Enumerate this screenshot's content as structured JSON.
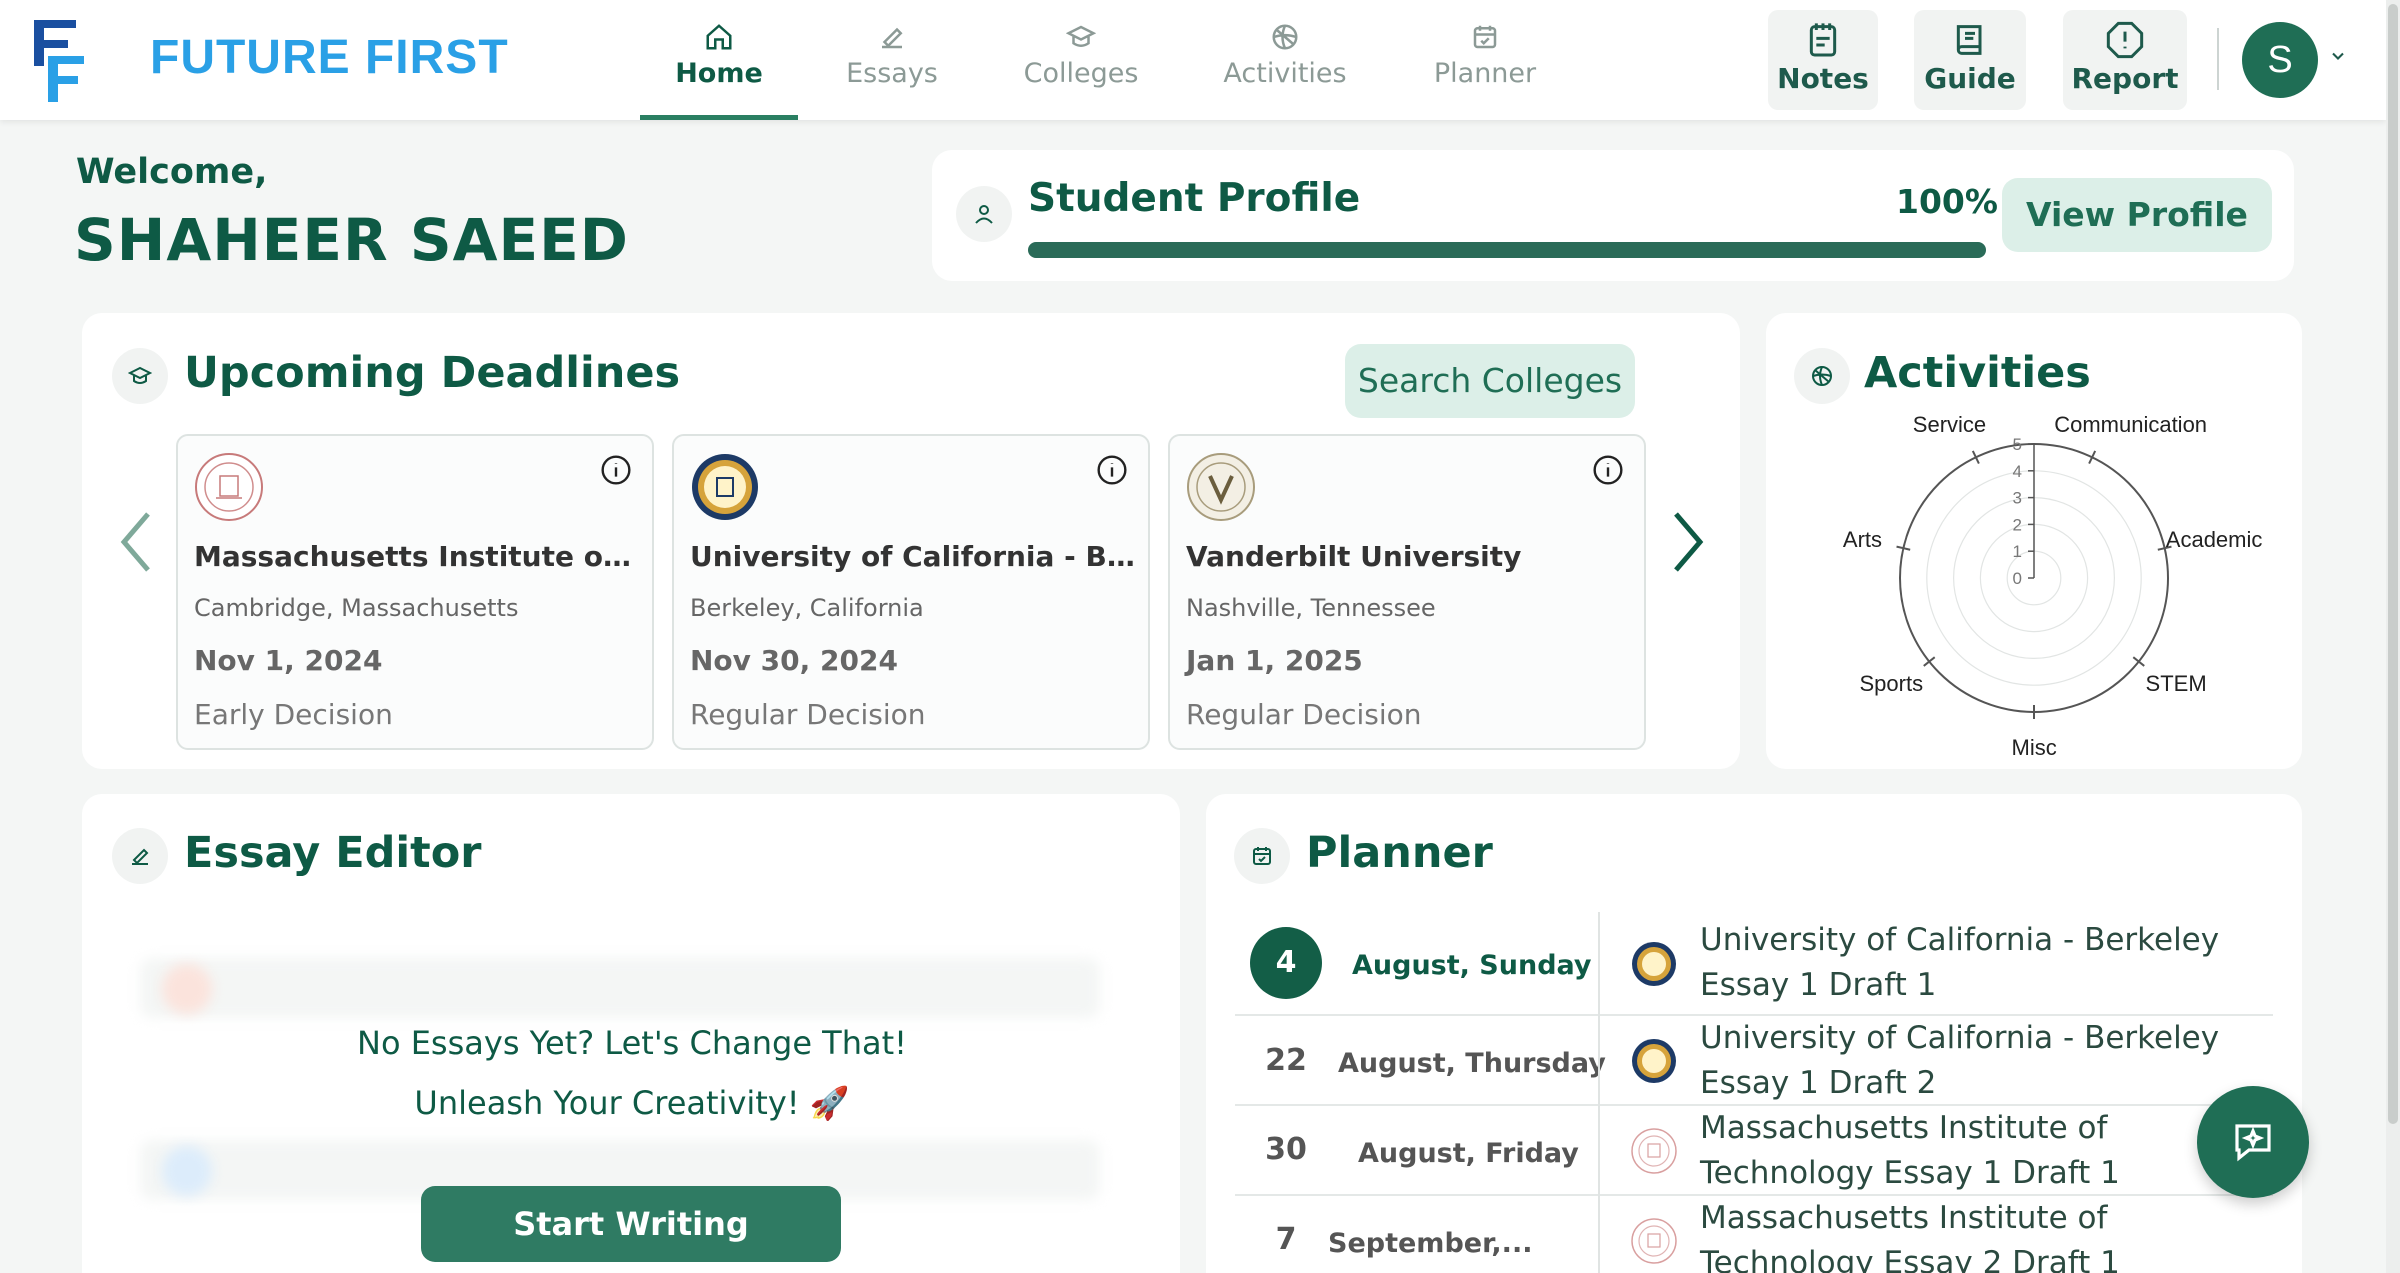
{
  "brand": "FUTURE FIRST",
  "nav": [
    {
      "label": "Home",
      "icon": "home-icon",
      "active": true
    },
    {
      "label": "Essays",
      "icon": "essay-icon"
    },
    {
      "label": "Colleges",
      "icon": "graduation-cap-icon"
    },
    {
      "label": "Activities",
      "icon": "activity-ball-icon"
    },
    {
      "label": "Planner",
      "icon": "calendar-icon"
    }
  ],
  "tools": [
    {
      "label": "Notes",
      "icon": "notes-icon"
    },
    {
      "label": "Guide",
      "icon": "book-icon"
    },
    {
      "label": "Report",
      "icon": "alert-icon"
    }
  ],
  "user": {
    "initial": "S"
  },
  "welcome": {
    "greeting": "Welcome,",
    "name": "SHAHEER SAEED"
  },
  "profile": {
    "title": "Student Profile",
    "percent_text": "100%",
    "progress": 1.0,
    "button": "View Profile"
  },
  "deadlines": {
    "title": "Upcoming Deadlines",
    "search_button": "Search Colleges",
    "cards": [
      {
        "name": "Massachusetts Institute of Tec...",
        "location": "Cambridge, Massachusetts",
        "date": "Nov 1, 2024",
        "type": "Early Decision"
      },
      {
        "name": "University of California - Berke...",
        "location": "Berkeley, California",
        "date": "Nov 30, 2024",
        "type": "Regular Decision"
      },
      {
        "name": "Vanderbilt University",
        "location": "Nashville, Tennessee",
        "date": "Jan 1, 2025",
        "type": "Regular Decision"
      }
    ]
  },
  "activities": {
    "title": "Activities",
    "axes": [
      "Communication",
      "Academic",
      "STEM",
      "Misc",
      "Sports",
      "Arts",
      "Service"
    ],
    "ticks": [
      "0",
      "1",
      "2",
      "3",
      "4",
      "5"
    ],
    "values": [
      0,
      0,
      0,
      0,
      0,
      0,
      0
    ]
  },
  "essay_editor": {
    "title": "Essay Editor",
    "empty_line1": "No Essays Yet? Let's Change That!",
    "empty_line2": "Unleash Your Creativity! 🚀",
    "button": "Start Writing"
  },
  "planner": {
    "title": "Planner",
    "rows": [
      {
        "day": "4",
        "date": "August, Sunday",
        "line1": "University of California - Berkeley",
        "line2": "Essay 1 Draft 1",
        "college": "berkeley"
      },
      {
        "day": "22",
        "date": "August, Thursday",
        "line1": "University of California - Berkeley",
        "line2": "Essay 1 Draft 2",
        "college": "berkeley"
      },
      {
        "day": "30",
        "date": "August, Friday",
        "line1": "Massachusetts Institute of",
        "line2": "Technology Essay 1 Draft 1",
        "college": "mit"
      },
      {
        "day": "7",
        "date": "September,...",
        "line1": "Massachusetts Institute of",
        "line2": "Technology Essay 2 Draft 1",
        "college": "mit"
      }
    ]
  },
  "colors": {
    "primary": "#0e5a45",
    "accent": "#2f7b63",
    "brand_blue": "#2aa0e6"
  }
}
